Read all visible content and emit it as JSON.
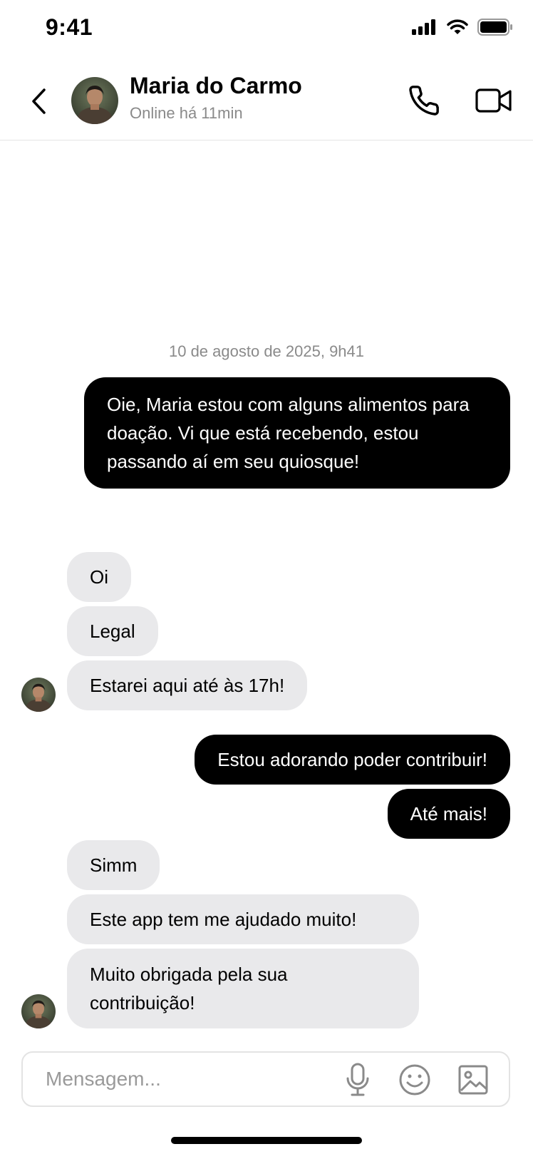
{
  "status_bar": {
    "time": "9:41"
  },
  "header": {
    "contact_name": "Maria do Carmo",
    "contact_status": "Online há 11min",
    "back_icon": "chevron-left-icon",
    "call_icon": "phone-icon",
    "video_icon": "video-camera-icon"
  },
  "conversation": {
    "date_separator": "10 de agosto de 2025, 9h41",
    "messages": [
      {
        "direction": "outgoing",
        "text": "Oie, Maria estou com alguns alimentos para doação. Vi que está recebendo, estou passando aí em seu quiosque!"
      },
      {
        "direction": "incoming",
        "text": "Oi"
      },
      {
        "direction": "incoming",
        "text": "Legal"
      },
      {
        "direction": "incoming",
        "text": "Estarei aqui até às 17h!"
      },
      {
        "direction": "outgoing",
        "text": "Estou adorando poder contribuir!"
      },
      {
        "direction": "outgoing",
        "text": "Até mais!"
      },
      {
        "direction": "incoming",
        "text": "Simm"
      },
      {
        "direction": "incoming",
        "text": "Este app tem me ajudado muito!"
      },
      {
        "direction": "incoming",
        "text": "Muito obrigada pela sua contribuição!"
      }
    ]
  },
  "composer": {
    "placeholder": "Mensagem...",
    "value": "",
    "mic_icon": "microphone-icon",
    "emoji_icon": "smiley-icon",
    "image_icon": "image-icon"
  },
  "colors": {
    "outgoing_bubble": "#000000",
    "incoming_bubble": "#e9e9eb",
    "muted_text": "#8a8a8a"
  }
}
